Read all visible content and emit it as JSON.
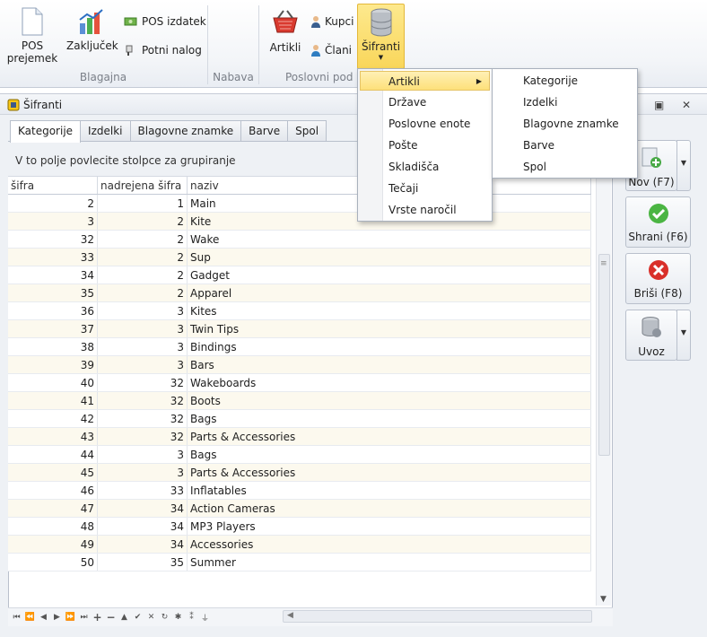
{
  "ribbon": {
    "groups": [
      {
        "label": "Blagajna"
      },
      {
        "label": "Nabava"
      },
      {
        "label": "Poslovni pod"
      }
    ],
    "buttons": {
      "pos_prejemek": "POS\nprejemek",
      "zakljucek": "Zaključek",
      "pos_izdatek": "POS izdatek",
      "potni_nalog": "Potni nalog",
      "artikli": "Artikli",
      "kupci": "Kupci",
      "clani": "Člani",
      "sifranti": "Šifranti"
    }
  },
  "window": {
    "title": "Šifranti"
  },
  "tabs": [
    "Kategorije",
    "Izdelki",
    "Blagovne znamke",
    "Barve",
    "Spol"
  ],
  "grid": {
    "group_hint": "V to polje povlecite stolpce za grupiranje",
    "columns": [
      "šifra",
      "nadrejena šifra",
      "naziv"
    ],
    "rows": [
      [
        "2",
        "1",
        "Main"
      ],
      [
        "3",
        "2",
        "Kite"
      ],
      [
        "32",
        "2",
        "Wake"
      ],
      [
        "33",
        "2",
        "Sup"
      ],
      [
        "34",
        "2",
        "Gadget"
      ],
      [
        "35",
        "2",
        "Apparel"
      ],
      [
        "36",
        "3",
        "Kites"
      ],
      [
        "37",
        "3",
        "Twin Tips"
      ],
      [
        "38",
        "3",
        "Bindings"
      ],
      [
        "39",
        "3",
        "Bars"
      ],
      [
        "40",
        "32",
        "Wakeboards"
      ],
      [
        "41",
        "32",
        "Boots"
      ],
      [
        "42",
        "32",
        "Bags"
      ],
      [
        "43",
        "32",
        "Parts & Accessories"
      ],
      [
        "44",
        "3",
        "Bags"
      ],
      [
        "45",
        "3",
        "Parts & Accessories"
      ],
      [
        "46",
        "33",
        "Inflatables"
      ],
      [
        "47",
        "34",
        "Action Cameras"
      ],
      [
        "48",
        "34",
        "MP3 Players"
      ],
      [
        "49",
        "34",
        "Accessories"
      ],
      [
        "50",
        "35",
        "Summer"
      ]
    ]
  },
  "actions": {
    "nov": "Nov (F7)",
    "shrani": "Shrani (F6)",
    "brisi": "Briši (F8)",
    "uvoz": "Uvoz"
  },
  "menu": {
    "items": [
      "Artikli",
      "Države",
      "Poslovne enote",
      "Pošte",
      "Skladišča",
      "Tečaji",
      "Vrste naročil"
    ],
    "submenu": [
      "Kategorije",
      "Izdelki",
      "Blagovne znamke",
      "Barve",
      "Spol"
    ]
  },
  "colors": {
    "accent_highlight": "#fde07a",
    "row_alt": "#fcf9ee"
  }
}
